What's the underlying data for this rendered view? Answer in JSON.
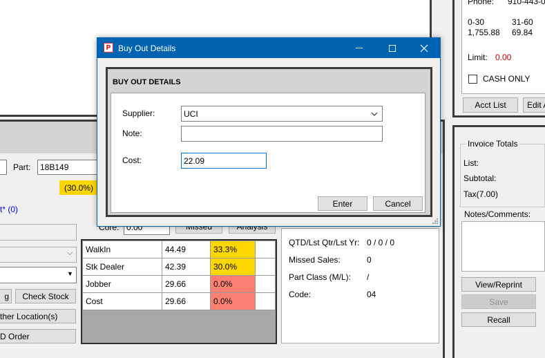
{
  "right_top": {
    "phone_label": "Phone:",
    "phone_value": "910-443-0",
    "aging_headers": [
      "0-30",
      "31-60"
    ],
    "aging_values": [
      "1,755.88",
      "69.84"
    ],
    "limit_label": "Limit:",
    "limit_value": "0.00",
    "cash_only_label": "CASH ONLY",
    "acct_list_label": "Acct List",
    "edit_label": "Edit A"
  },
  "invoice_totals": {
    "group_title": "Invoice Totals",
    "list_label": "List:",
    "subtotal_label": "Subtotal:",
    "tax_label": "Tax(7.00)",
    "notes_label": "Notes/Comments:",
    "view_reprint_label": "View/Reprint",
    "save_label": "Save",
    "recall_label": "Recall"
  },
  "left_panel": {
    "part_label": "Part:",
    "part_value": "18B149",
    "percent_badge": "(30.0%)",
    "link_text": "t* (0)",
    "g_button": "g",
    "check_stock_label": "Check Stock",
    "other_location_label": "ther Location(s)",
    "d_order_label": "D Order",
    "core_label": "Core:",
    "core_value": "0.00",
    "missed_label": "Missed",
    "analysis_label": "Analysis"
  },
  "price_table": {
    "rows": [
      {
        "name": "WalkIn",
        "price": "44.49",
        "pct": "33.3%",
        "color": "#ffd700"
      },
      {
        "name": "Stk Dealer",
        "price": "42.39",
        "pct": "30.0%",
        "color": "#ffd700"
      },
      {
        "name": "Jobber",
        "price": "29.66",
        "pct": "0.0%",
        "color": "#fa8072"
      },
      {
        "name": "Cost",
        "price": "29.66",
        "pct": "0.0%",
        "color": "#fa8072"
      }
    ]
  },
  "stats": {
    "qtd_label": "QTD/Lst Qtr/Lst Yr:",
    "qtd_value": "0 / 0 / 0",
    "missed_sales_label": "Missed Sales:",
    "missed_sales_value": "0",
    "part_class_label": "Part Class (M/L):",
    "part_class_value": "/",
    "code_label": "Code:",
    "code_value": "04"
  },
  "dialog": {
    "title": "Buy Out Details",
    "app_icon_letter": "P",
    "header": "BUY OUT DETAILS",
    "supplier_label": "Supplier:",
    "supplier_value": "UCI",
    "note_label": "Note:",
    "note_value": "",
    "cost_label": "Cost:",
    "cost_value": "22.09",
    "enter_label": "Enter",
    "cancel_label": "Cancel",
    "accent": "#0063b1"
  }
}
